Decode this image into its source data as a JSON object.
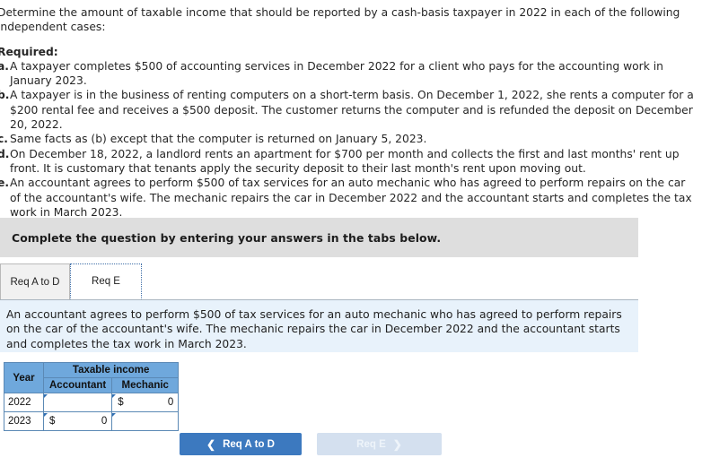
{
  "question": {
    "intro": "Determine the amount of taxable income that should be reported by a cash-basis taxpayer in 2022 in each of the following independent cases:",
    "required_label": "Required:",
    "cases": [
      {
        "marker": "a.",
        "text": "A taxpayer completes $500 of accounting services in December 2022 for a client who pays for the accounting work in January 2023."
      },
      {
        "marker": "b.",
        "text": "A taxpayer is in the business of renting computers on a short-term basis. On December 1, 2022, she rents a computer for a $200 rental fee and receives a $500 deposit. The customer returns the computer and is refunded the deposit on December 20, 2022."
      },
      {
        "marker": "c.",
        "text": "Same facts as (b) except that the computer is returned on January 5, 2023."
      },
      {
        "marker": "d.",
        "text": "On December 18, 2022, a landlord rents an apartment for $700 per month and collects the first and last months' rent up front. It is customary that tenants apply the security deposit to their last month's rent upon moving out."
      },
      {
        "marker": "e.",
        "text": "An accountant agrees to perform $500 of tax services for an auto mechanic who has agreed to perform repairs on the car of the accountant's wife. The mechanic repairs the car in December 2022 and the accountant starts and completes the tax work in March 2023."
      }
    ]
  },
  "banner": {
    "text": "Complete the question by entering your answers in the tabs below."
  },
  "tabs": [
    {
      "label": "Req A to D",
      "active": false
    },
    {
      "label": "Req E",
      "active": true
    }
  ],
  "subpanel": {
    "text": "An accountant agrees to perform $500 of tax services for an auto mechanic who has agreed to perform repairs on the car of the accountant's wife. The mechanic repairs the car in December 2022 and the accountant starts and completes the tax work in March 2023."
  },
  "answer_table": {
    "header_year": "Year",
    "header_group": "Taxable income",
    "header_accountant": "Accountant",
    "header_mechanic": "Mechanic",
    "rows": [
      {
        "year": "2022",
        "accountant_currency": "",
        "accountant_value": "",
        "mechanic_currency": "$",
        "mechanic_value": "0"
      },
      {
        "year": "2023",
        "accountant_currency": "$",
        "accountant_value": "0",
        "mechanic_currency": "",
        "mechanic_value": ""
      }
    ]
  },
  "navigation": {
    "prev_label": "Req A to D",
    "prev_icon": "chevron-left-icon",
    "next_label": "Req E",
    "next_icon": "chevron-right-icon",
    "prev_color": "#3c79bf",
    "next_color": "#d4e0ef"
  }
}
